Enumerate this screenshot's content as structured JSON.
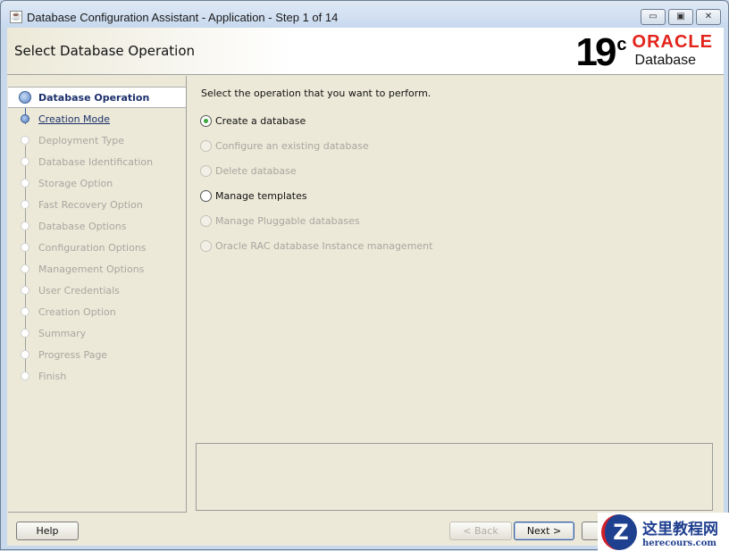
{
  "window": {
    "title": "Database Configuration Assistant - Application - Step 1 of 14",
    "controls": {
      "minimize": "▭",
      "maximize": "▣",
      "close": "✕"
    }
  },
  "header": {
    "title": "Select Database Operation",
    "logo": {
      "version": "19",
      "sup": "c",
      "brand": "ORACLE",
      "product": "Database"
    }
  },
  "steps": [
    {
      "label": "Database Operation",
      "state": "current"
    },
    {
      "label": "Creation Mode",
      "state": "link"
    },
    {
      "label": "Deployment Type",
      "state": "disabled"
    },
    {
      "label": "Database Identification",
      "state": "disabled"
    },
    {
      "label": "Storage Option",
      "state": "disabled"
    },
    {
      "label": "Fast Recovery Option",
      "state": "disabled"
    },
    {
      "label": "Database Options",
      "state": "disabled"
    },
    {
      "label": "Configuration Options",
      "state": "disabled"
    },
    {
      "label": "Management Options",
      "state": "disabled"
    },
    {
      "label": "User Credentials",
      "state": "disabled"
    },
    {
      "label": "Creation Option",
      "state": "disabled"
    },
    {
      "label": "Summary",
      "state": "disabled"
    },
    {
      "label": "Progress Page",
      "state": "disabled"
    },
    {
      "label": "Finish",
      "state": "disabled"
    }
  ],
  "content": {
    "prompt": "Select the operation that you want to perform.",
    "options": [
      {
        "label": "Create a database",
        "selected": true,
        "enabled": true
      },
      {
        "label": "Configure an existing database",
        "selected": false,
        "enabled": false
      },
      {
        "label": "Delete database",
        "selected": false,
        "enabled": false
      },
      {
        "label": "Manage templates",
        "selected": false,
        "enabled": true
      },
      {
        "label": "Manage Pluggable databases",
        "selected": false,
        "enabled": false
      },
      {
        "label": "Oracle RAC database Instance management",
        "selected": false,
        "enabled": false
      }
    ]
  },
  "buttons": {
    "help": "Help",
    "back": "< Back",
    "next": "Next >"
  },
  "watermark": {
    "title": "这里教程网",
    "url": "herecours.com",
    "mark": "Z"
  }
}
